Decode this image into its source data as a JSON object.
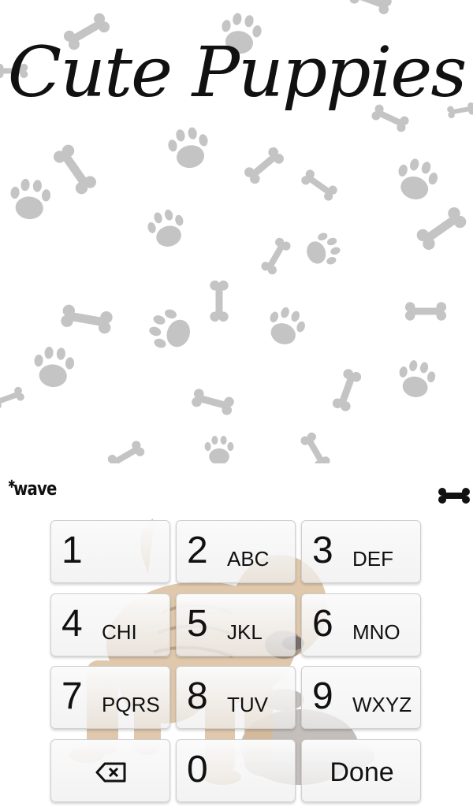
{
  "header": {
    "title": "Cute Puppies"
  },
  "keyboard": {
    "brand": "wave",
    "keys": [
      {
        "digit": "1",
        "letters": ""
      },
      {
        "digit": "2",
        "letters": "ABC"
      },
      {
        "digit": "3",
        "letters": "DEF"
      },
      {
        "digit": "4",
        "letters": "CHI"
      },
      {
        "digit": "5",
        "letters": "JKL"
      },
      {
        "digit": "6",
        "letters": "MNO"
      },
      {
        "digit": "7",
        "letters": "PQRS"
      },
      {
        "digit": "8",
        "letters": "TUV"
      },
      {
        "digit": "9",
        "letters": "WXYZ"
      },
      {
        "digit": "0",
        "letters": ""
      }
    ],
    "done_label": "Done",
    "backspace_icon": "backspace-icon",
    "menu_icon": "bone-icon"
  },
  "colors": {
    "pattern": "#c4c4c4",
    "text": "#111111"
  }
}
